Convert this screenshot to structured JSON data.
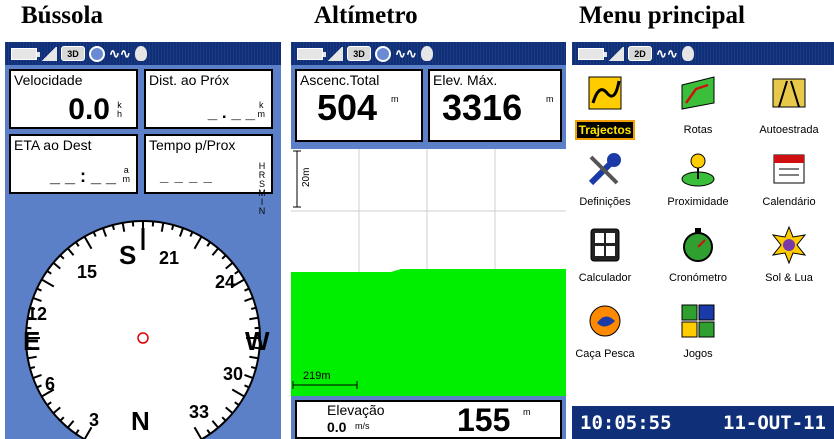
{
  "titles": {
    "compass": "Bússola",
    "altimeter": "Altímetro",
    "menu": "Menu principal"
  },
  "statusbar": {
    "mode_3d": "3D",
    "mode_2d": "2D"
  },
  "compass_screen": {
    "fields": [
      {
        "label": "Velocidade",
        "value": "0.0",
        "unit_top": "k",
        "unit_bottom": "h"
      },
      {
        "label": "Dist. ao Próx",
        "value": "_ . _ _",
        "unit_top": "k",
        "unit_bottom": "m"
      },
      {
        "label": "ETA ao Dest",
        "value": "_ _ : _ _",
        "unit_top": "a",
        "unit_bottom": "m"
      },
      {
        "label": "Tempo p/Prox",
        "value": "_ _ _ _",
        "unit_top": "H R S",
        "unit_bottom": "M I N"
      }
    ],
    "rose_labels": {
      "north": "N",
      "south": "S",
      "east": "E",
      "west": "W"
    },
    "rose_numbers": [
      "3",
      "6",
      "12",
      "15",
      "21",
      "24",
      "30",
      "33"
    ]
  },
  "altimeter_screen": {
    "total_ascent_label": "Ascenc.Total",
    "total_ascent_value": "504",
    "total_ascent_unit": "m",
    "max_elev_label": "Elev. Máx.",
    "max_elev_value": "3316",
    "max_elev_unit": "m",
    "y_scale_label": "20m",
    "x_scale_label": "219m",
    "elevation_label": "Elevação",
    "elevation_rate": "0.0",
    "elevation_value": "155",
    "elevation_unit": "m",
    "rate_unit": "m/s"
  },
  "menu_screen": {
    "items": [
      {
        "label": "Trajectos",
        "icon": "tracks-icon",
        "selected": true
      },
      {
        "label": "Rotas",
        "icon": "routes-icon"
      },
      {
        "label": "Autoestrada",
        "icon": "highway-icon"
      },
      {
        "label": "Definições",
        "icon": "settings-icon"
      },
      {
        "label": "Proximidade",
        "icon": "proximity-icon"
      },
      {
        "label": "Calendário",
        "icon": "calendar-icon"
      },
      {
        "label": "Calculador",
        "icon": "calculator-icon"
      },
      {
        "label": "Cronómetro",
        "icon": "stopwatch-icon"
      },
      {
        "label": "Sol & Lua",
        "icon": "sun-moon-icon"
      },
      {
        "label": "Caça Pesca",
        "icon": "hunt-fish-icon"
      },
      {
        "label": "Jogos",
        "icon": "games-icon"
      }
    ],
    "time": "10:05:55",
    "date": "11-OUT-11"
  },
  "colors": {
    "statusbar": "#0f2f78",
    "panel_blue": "#5b80c8",
    "terrain_green": "#00ee00",
    "selected_label_bg": "#000000",
    "selected_label_text": "#ffe600"
  }
}
